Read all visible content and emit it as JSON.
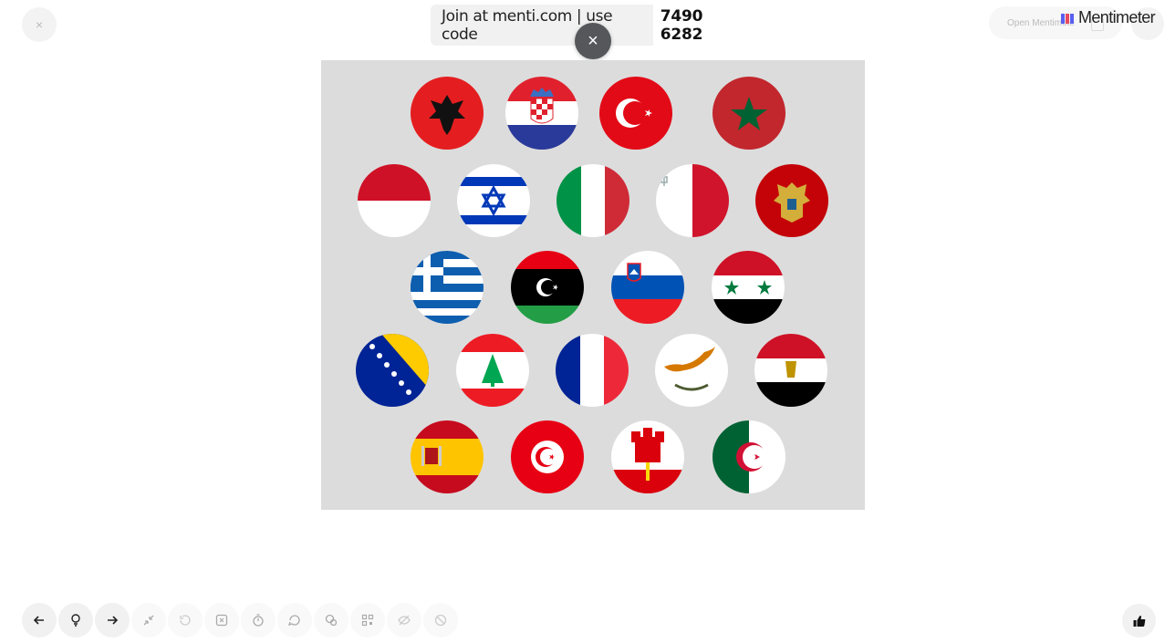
{
  "top": {
    "close_glyph": "×",
    "join_text": "Join at menti.com | use code",
    "code": "7490 6282",
    "qr_close_glyph": "×",
    "open_label": "Open Mentimote",
    "brand": "Mentimeter"
  },
  "slide": {
    "flags": [
      {
        "row": 1,
        "id": "albania",
        "icon": "flag-albania-icon"
      },
      {
        "row": 1,
        "id": "croatia",
        "icon": "flag-croatia-icon"
      },
      {
        "row": 1,
        "id": "turkey",
        "icon": "flag-turkey-icon"
      },
      {
        "row": 1,
        "id": "morocco",
        "icon": "flag-morocco-icon"
      },
      {
        "row": 2,
        "id": "monaco",
        "icon": "flag-monaco-icon"
      },
      {
        "row": 2,
        "id": "israel",
        "icon": "flag-israel-icon"
      },
      {
        "row": 2,
        "id": "italy",
        "icon": "flag-italy-icon"
      },
      {
        "row": 2,
        "id": "malta",
        "icon": "flag-malta-icon"
      },
      {
        "row": 2,
        "id": "montenegro",
        "icon": "flag-montenegro-icon"
      },
      {
        "row": 3,
        "id": "greece",
        "icon": "flag-greece-icon"
      },
      {
        "row": 3,
        "id": "libya",
        "icon": "flag-libya-icon"
      },
      {
        "row": 3,
        "id": "slovenia",
        "icon": "flag-slovenia-icon"
      },
      {
        "row": 3,
        "id": "syria",
        "icon": "flag-syria-icon"
      },
      {
        "row": 4,
        "id": "bosnia",
        "icon": "flag-bosnia-icon"
      },
      {
        "row": 4,
        "id": "lebanon",
        "icon": "flag-lebanon-icon"
      },
      {
        "row": 4,
        "id": "france",
        "icon": "flag-france-icon"
      },
      {
        "row": 4,
        "id": "cyprus",
        "icon": "flag-cyprus-icon"
      },
      {
        "row": 4,
        "id": "egypt",
        "icon": "flag-egypt-icon"
      },
      {
        "row": 5,
        "id": "spain",
        "icon": "flag-spain-icon"
      },
      {
        "row": 5,
        "id": "tunisia",
        "icon": "flag-tunisia-icon"
      },
      {
        "row": 5,
        "id": "gibraltar",
        "icon": "flag-gibraltar-icon"
      },
      {
        "row": 5,
        "id": "algeria",
        "icon": "flag-algeria-icon"
      }
    ]
  },
  "toolbar": {
    "buttons": [
      {
        "name": "previous-button",
        "icon": "arrow-left-icon"
      },
      {
        "name": "hint-button",
        "icon": "lightbulb-icon"
      },
      {
        "name": "next-button",
        "icon": "arrow-right-icon"
      },
      {
        "name": "fullscreen-button",
        "icon": "collapse-icon"
      },
      {
        "name": "reset-button",
        "icon": "reset-icon"
      },
      {
        "name": "hide-results-button",
        "icon": "hidden-box-icon"
      },
      {
        "name": "timer-button",
        "icon": "timer-icon"
      },
      {
        "name": "comments-button",
        "icon": "chat-bubble-icon"
      },
      {
        "name": "qa-button",
        "icon": "chat-bubbles-icon"
      },
      {
        "name": "qr-button",
        "icon": "qr-code-icon"
      },
      {
        "name": "visibility-button",
        "icon": "eye-off-icon"
      },
      {
        "name": "block-button",
        "icon": "block-icon"
      }
    ],
    "like_icon": "thumbs-up-icon"
  },
  "colors": {
    "background": "#ffffff",
    "slide_background": "#dcdcdc",
    "toolbar_button": "#f1f1f1",
    "qr_close": "#55575a"
  }
}
